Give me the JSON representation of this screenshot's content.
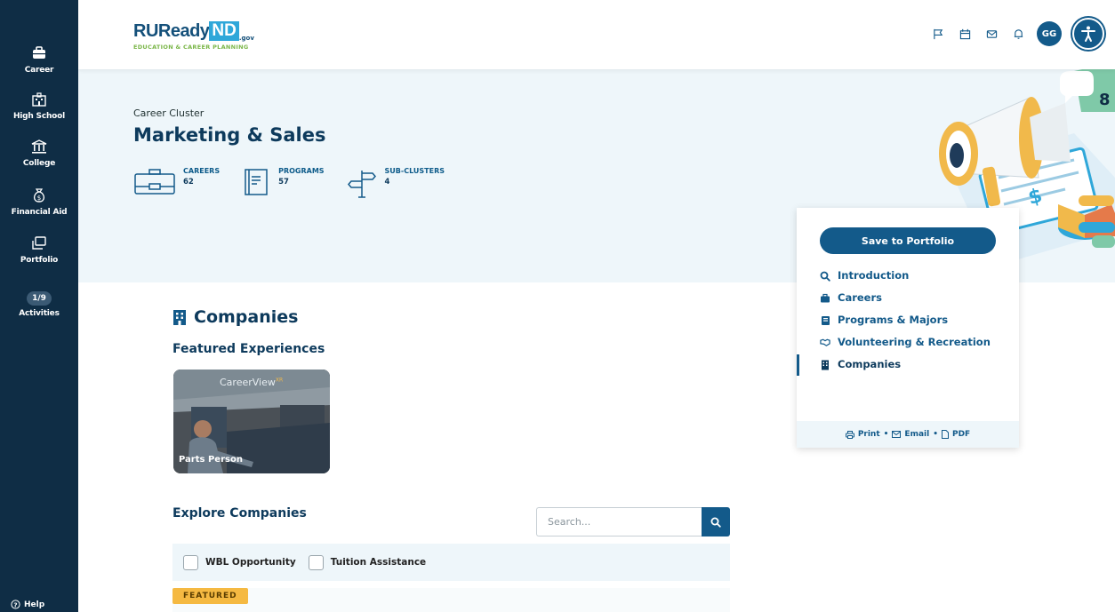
{
  "sidebar": {
    "items": [
      {
        "label": "Career",
        "icon": "briefcase-icon"
      },
      {
        "label": "High School",
        "icon": "school-icon"
      },
      {
        "label": "College",
        "icon": "college-icon"
      },
      {
        "label": "Financial Aid",
        "icon": "money-bag-icon"
      },
      {
        "label": "Portfolio",
        "icon": "portfolio-icon"
      },
      {
        "label": "Activities",
        "badge": "1/9"
      }
    ],
    "help": "Help"
  },
  "header": {
    "logo_ru": "RUReady",
    "logo_nd": "ND",
    "logo_gov": ".gov",
    "logo_tagline": "EDUCATION & CAREER PLANNING",
    "avatar": "GG"
  },
  "hero": {
    "kicker": "Career Cluster",
    "title": "Marketing & Sales",
    "stats": [
      {
        "label": "CAREERS",
        "value": "62"
      },
      {
        "label": "PROGRAMS",
        "value": "57"
      },
      {
        "label": "SUB-CLUSTERS",
        "value": "4"
      }
    ]
  },
  "content": {
    "section_title": "Companies",
    "featured_title": "Featured Experiences",
    "card": {
      "brand": "CareerView",
      "brand_sup": "XR",
      "caption": "Parts Person"
    },
    "explore_title": "Explore Companies",
    "search_placeholder": "Search...",
    "filters": [
      "WBL Opportunity",
      "Tuition Assistance"
    ],
    "featured_badge": "FEATURED"
  },
  "nav": {
    "save": "Save to Portfolio",
    "items": [
      "Introduction",
      "Careers",
      "Programs & Majors",
      "Volunteering & Recreation",
      "Companies"
    ],
    "print": "Print",
    "email": "Email",
    "pdf": "PDF",
    "sep": "•"
  },
  "colors": {
    "sidebar": "#0f2d45",
    "primary": "#135a8a",
    "accent": "#2fa7d9",
    "badge": "#f5b942",
    "hero_bg": "#eef6fa"
  }
}
